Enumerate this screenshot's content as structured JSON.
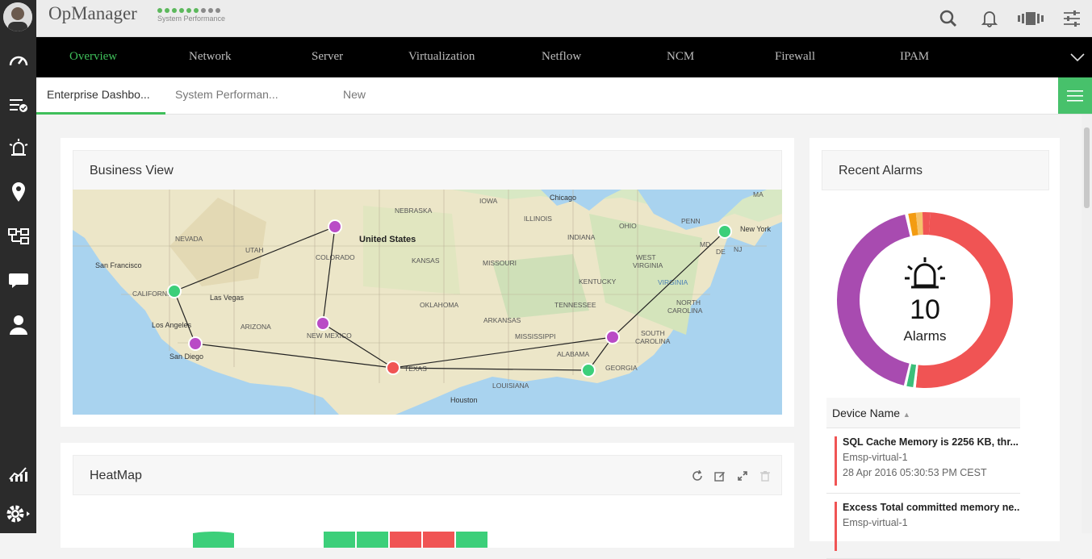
{
  "app": {
    "title": "OpManager",
    "performance_label": "System Performance",
    "performance_dots": [
      1,
      1,
      1,
      1,
      1,
      1,
      0,
      0,
      0
    ]
  },
  "nav": {
    "items": [
      "Overview",
      "Network",
      "Server",
      "Virtualization",
      "Netflow",
      "NCM",
      "Firewall",
      "IPAM"
    ],
    "active": "Overview"
  },
  "tabs": {
    "items": [
      "Enterprise Dashbo...",
      "System Performan...",
      "New"
    ],
    "active": "Enterprise Dashbo..."
  },
  "business_view": {
    "title": "Business View",
    "map_labels": {
      "country": "United States",
      "cities": [
        "San Francisco",
        "Las Vegas",
        "Los Angeles",
        "San Diego",
        "Chicago",
        "Houston",
        "New York"
      ],
      "states": [
        "NEVADA",
        "CALIFORNIA",
        "UTAH",
        "COLORADO",
        "ARIZONA",
        "NEW MEXICO",
        "NEBRASKA",
        "KANSAS",
        "OKLAHOMA",
        "TEXAS",
        "IOWA",
        "ILLINOIS",
        "MISSOURI",
        "ARKANSAS",
        "MISSISSIPPI",
        "LOUISIANA",
        "ALABAMA",
        "GEORGIA",
        "TENNESSEE",
        "KENTUCKY",
        "INDIANA",
        "OHIO",
        "WEST VIRGINIA",
        "VIRGINIA",
        "NORTH CAROLINA",
        "SOUTH CAROLINA",
        "PENN",
        "MD",
        "DE",
        "NJ",
        "MA"
      ]
    }
  },
  "heatmap": {
    "title": "HeatMap"
  },
  "recent_alarms": {
    "title": "Recent Alarms",
    "count": "10",
    "count_label": "Alarms",
    "table_header": "Device Name",
    "rows": [
      {
        "title": "SQL Cache Memory is 2256 KB, thr...",
        "device": "Emsp-virtual-1",
        "time": "28 Apr 2016 05:30:53 PM CEST"
      },
      {
        "title": "Excess Total committed memory ne...",
        "device": "Emsp-virtual-1",
        "time": ""
      }
    ]
  },
  "colors": {
    "accent": "#3fbf5a",
    "critical": "#f05454",
    "major": "#f39c12",
    "trouble": "#a84bb0",
    "clear": "#3cbf7a",
    "purple_node": "#b94bc6",
    "green_node": "#3ccf7a",
    "red_node": "#f05454"
  }
}
